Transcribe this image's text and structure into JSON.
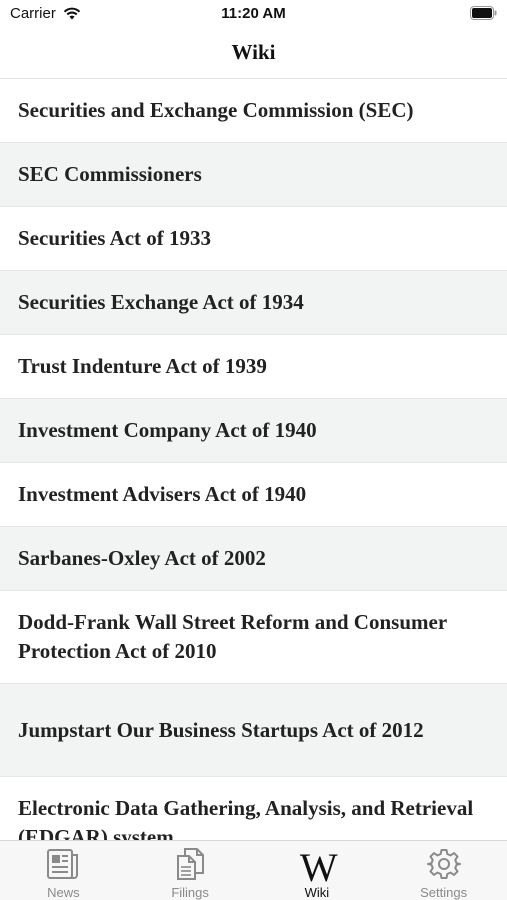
{
  "status_bar": {
    "carrier": "Carrier",
    "time": "11:20 AM"
  },
  "nav": {
    "title": "Wiki"
  },
  "wiki_items": [
    {
      "label": "Securities and Exchange Commission (SEC)"
    },
    {
      "label": "SEC Commissioners"
    },
    {
      "label": "Securities Act of 1933"
    },
    {
      "label": "Securities Exchange Act of 1934"
    },
    {
      "label": "Trust Indenture Act of 1939"
    },
    {
      "label": "Investment Company Act of 1940"
    },
    {
      "label": "Investment Advisers Act of 1940"
    },
    {
      "label": "Sarbanes-Oxley Act of 2002"
    },
    {
      "label": "Dodd-Frank Wall Street Reform and Consumer Protection Act of 2010"
    },
    {
      "label": "Jumpstart Our Business Startups Act of 2012"
    },
    {
      "label": "Electronic Data Gathering, Analysis, and Retrieval (EDGAR) system"
    }
  ],
  "tab_bar": {
    "tabs": [
      {
        "label": "News",
        "icon": "newspaper-icon"
      },
      {
        "label": "Filings",
        "icon": "documents-icon"
      },
      {
        "label": "Wiki",
        "icon": "wiki-w-icon",
        "glyph": "W",
        "active": true
      },
      {
        "label": "Settings",
        "icon": "gear-icon"
      }
    ]
  },
  "colors": {
    "alt_row": "#f2f4f3",
    "active_tab": "#111111",
    "inactive_tab": "#8a8a8a"
  }
}
